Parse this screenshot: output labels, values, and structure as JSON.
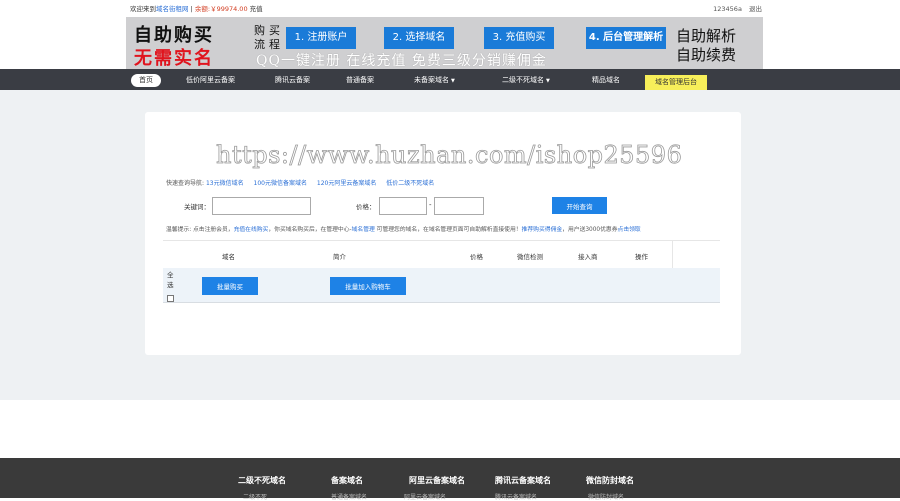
{
  "topbar": {
    "welcome_prefix": "欢迎来到",
    "site_name": "域名街租网",
    "sep": "|",
    "balance_label": "余额:",
    "balance_value": "￥99974.00",
    "recharge": "充值",
    "username": "123456a",
    "logout": "退出"
  },
  "banner": {
    "headline1": "自助购买",
    "headline2": "无需实名",
    "flow_label": "购买流程",
    "steps": [
      "1. 注册账户",
      "2. 选择域名",
      "3. 充值购买",
      "4. 后台管理解析"
    ],
    "slogan": "QQ一键注册   在线充值   免费三级分销赚佣金",
    "right1": "自助解析",
    "right2": "自助续费"
  },
  "nav": {
    "items": [
      "首页",
      "低价阿里云备案",
      "腾讯云备案",
      "普通备案",
      "未备案域名",
      "二级不死域名",
      "精品域名",
      "域名管理后台"
    ]
  },
  "watermark": "https://www.huzhan.com/ishop25596",
  "quick": {
    "label": "快速查询导航:",
    "links": [
      "13元微信域名",
      "100元微信备案域名",
      "120元阿里云备案域名",
      "低价二级不死域名"
    ]
  },
  "search": {
    "keyword_label": "关键词：",
    "keyword_value": "",
    "price_label": "价格：",
    "price_min": "",
    "price_max": "",
    "dash": "-",
    "submit": "开始查询"
  },
  "tip": {
    "prefix": "温馨提示: 点击注册会员，",
    "link1": "充值在线购买",
    "middle": "，你买域名购买后，在管理中心-",
    "link2": "域名管理",
    "middle2": " 可管理您的域名，在域名管理页面可自助解析直接使用！",
    "link3": "推荐购买得佣金",
    "suffix": "，用户送3000优惠券",
    "link4": "点击领取"
  },
  "table": {
    "headers": [
      "域名",
      "简介",
      "价格",
      "微信检测",
      "接入商",
      "操作"
    ],
    "select_all": "全选",
    "bulk_buy": "批量购买",
    "bulk_cart": "批量加入购物车"
  },
  "footer": {
    "columns": [
      "二级不死域名",
      "备案域名",
      "阿里云备案域名",
      "腾讯云备案域名",
      "微信防封域名"
    ],
    "subs": [
      "二级不死",
      "普通备案域名",
      "阿里云备案域名",
      "腾讯云备案域名",
      "微信防封域名"
    ]
  }
}
